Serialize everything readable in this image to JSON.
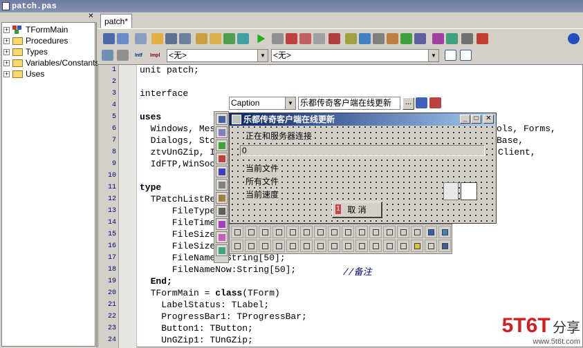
{
  "window": {
    "title": "patch.pas"
  },
  "left_panel": {
    "close_glyph": "✕",
    "tree": [
      {
        "label": "TFormMain",
        "kind": "class"
      },
      {
        "label": "Procedures",
        "kind": "folder"
      },
      {
        "label": "Types",
        "kind": "folder"
      },
      {
        "label": "Variables/Constants",
        "kind": "folder"
      },
      {
        "label": "Uses",
        "kind": "folder"
      }
    ]
  },
  "tabs": [
    {
      "label": "patch*"
    }
  ],
  "toolbar": {
    "combo1": "<无>",
    "combo2": "<无>",
    "intf_label": "Intf",
    "impl_label": "Impl"
  },
  "editor": {
    "line_numbers": [
      "1",
      "2",
      "3",
      "4",
      "5",
      "6",
      "7",
      "8",
      "9",
      "10",
      "11",
      "12",
      "13",
      "14",
      "15",
      "16",
      "17",
      "18",
      "19",
      "20",
      "21",
      "22",
      "23",
      "24"
    ],
    "lines": {
      "l1": "unit patch;",
      "l3": "interface",
      "l5": "uses",
      "l6": "  Windows, Mes",
      "l6b": "ols, Forms,",
      "l7": "  Dialogs, Sto",
      "l7b": "Base,",
      "l8": "  ztvUnGZip, I",
      "l8b": "Client,",
      "l9": "  IdFTP,WinSoc",
      "l11": "type",
      "l12": "  TPatchListRe",
      "l13": "      FileType",
      "l14": "      FileTime",
      "l15": "      FileSize",
      "l16": "      FileSizeN",
      "l17": "      FileName :String[50];",
      "l18": "      FileNameNow:String[50];",
      "l18c": "//备注",
      "l19": "  End;",
      "l20a": "  TFormMain = ",
      "l20k": "class",
      "l20b": "(TForm)",
      "l21": "    LabelStatus: TLabel;",
      "l22": "    ProgressBar1: TProgressBar;",
      "l23": "    Button1: TButton;",
      "l24": "    UnGZip1: TUnGZip;"
    }
  },
  "property_bar": {
    "property_name": "Caption",
    "property_value": "乐都传奇客户端在线更新",
    "ellipsis": "..."
  },
  "form": {
    "title": "乐都传奇客户端在线更新",
    "status_label": "正在和服务器连接",
    "progress_text": "0",
    "current_file_label": "当前文件",
    "all_files_label": "所有文件",
    "speed_label": "当前速度",
    "cancel_label": "取  消",
    "cancel_badge": "1",
    "min_glyph": "_",
    "max_glyph": "□",
    "close_glyph": "✕"
  },
  "watermark": {
    "brand": "5T6T",
    "sub": "www.5t6t.com",
    "suffix": "分享"
  }
}
